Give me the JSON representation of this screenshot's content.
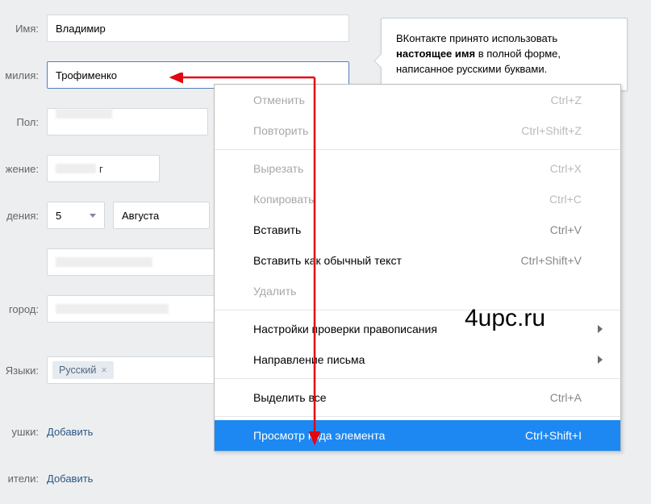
{
  "form": {
    "name_label": "Имя:",
    "name_value": "Владимир",
    "surname_label": "милия:",
    "surname_value": "Трофименко",
    "gender_label": "Пол:",
    "gender_value": "",
    "marital_label": "жение:",
    "marital_value_suffix": "г",
    "birthdate_label": "дения:",
    "birth_day": "5",
    "birth_month": "Августа",
    "city_label": "город:",
    "city_value": "",
    "languages_label": "Языки:",
    "language_tag": "Русский",
    "language_tag_close": "×",
    "grandparents_label": "ушки:",
    "grandparents_action": "Добавить",
    "parents_label": "ители:",
    "parents_action": "Добавить"
  },
  "hint": {
    "line1_pre": "ВКонтакте принято использовать ",
    "line1_bold": "настоящее имя",
    "line1_post": " в полной форме, написанное русскими буквами."
  },
  "menu": {
    "undo": "Отменить",
    "undo_k": "Ctrl+Z",
    "redo": "Повторить",
    "redo_k": "Ctrl+Shift+Z",
    "cut": "Вырезать",
    "cut_k": "Ctrl+X",
    "copy": "Копировать",
    "copy_k": "Ctrl+C",
    "paste": "Вставить",
    "paste_k": "Ctrl+V",
    "paste_plain": "Вставить как обычный текст",
    "paste_plain_k": "Ctrl+Shift+V",
    "delete": "Удалить",
    "spellcheck": "Настройки проверки правописания",
    "direction": "Направление письма",
    "select_all": "Выделить все",
    "select_all_k": "Ctrl+A",
    "inspect": "Просмотр кода элемента",
    "inspect_k": "Ctrl+Shift+I"
  },
  "watermark": "4upc.ru"
}
